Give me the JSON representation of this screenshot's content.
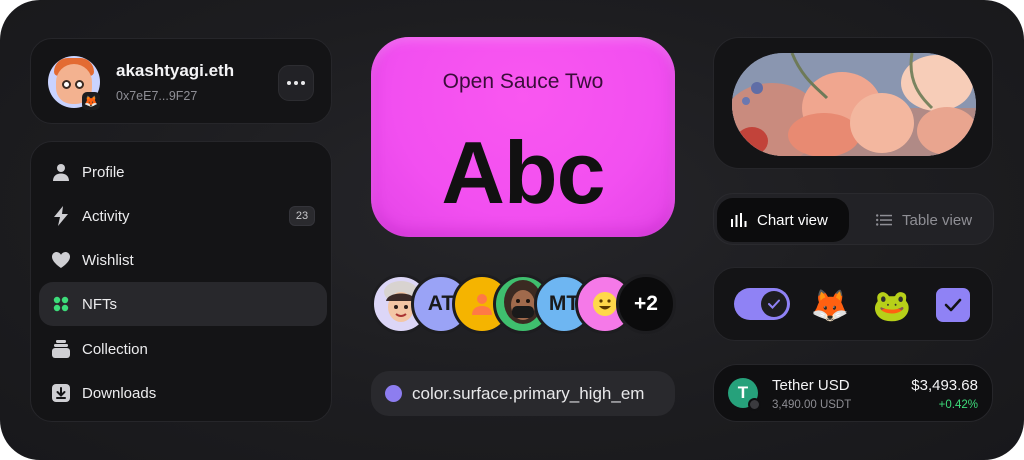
{
  "user": {
    "name": "akashtyagi.eth",
    "address": "0x7eE7...9F27"
  },
  "nav": {
    "items": [
      {
        "label": "Profile",
        "icon": "user-icon"
      },
      {
        "label": "Activity",
        "icon": "lightning-icon",
        "count": "23"
      },
      {
        "label": "Wishlist",
        "icon": "heart-icon"
      },
      {
        "label": "NFTs",
        "icon": "grid-dots-icon",
        "active": true
      },
      {
        "label": "Collection",
        "icon": "stack-icon"
      },
      {
        "label": "Downloads",
        "icon": "download-icon"
      }
    ]
  },
  "font_card": {
    "font_name": "Open Sauce Two",
    "sample": "Abc",
    "color": "#f24ff0"
  },
  "avatars": [
    {
      "initials": "",
      "bg": "#dcd6f7",
      "kind": "memoji"
    },
    {
      "initials": "AT",
      "bg": "#9aa3f6"
    },
    {
      "initials": "",
      "bg": "#f5b400",
      "kind": "person-icon"
    },
    {
      "initials": "",
      "bg": "#3fbf6e",
      "kind": "memoji-dark"
    },
    {
      "initials": "MT",
      "bg": "#6eb6f2"
    },
    {
      "initials": "",
      "bg": "#f579e8",
      "kind": "emoji"
    },
    {
      "initials": "+2",
      "bg": "#0b0b0c",
      "fg": "#ffffff"
    }
  ],
  "token_chip": {
    "label": "color.surface.primary_high_em",
    "swatch": "#8d7df0"
  },
  "view_toggle": {
    "chart_label": "Chart view",
    "table_label": "Table view",
    "selected": "Chart view"
  },
  "controls": {
    "toggle_on": true,
    "checkbox_checked": true,
    "accent": "#8f82f5",
    "emoji_1": "🦊",
    "emoji_2": "🐸"
  },
  "asset": {
    "name": "Tether USD",
    "amount": "3,490.00 USDT",
    "value": "$3,493.68",
    "change": "+0.42%",
    "change_color": "#3ddc7a",
    "logo_letter": "T"
  }
}
